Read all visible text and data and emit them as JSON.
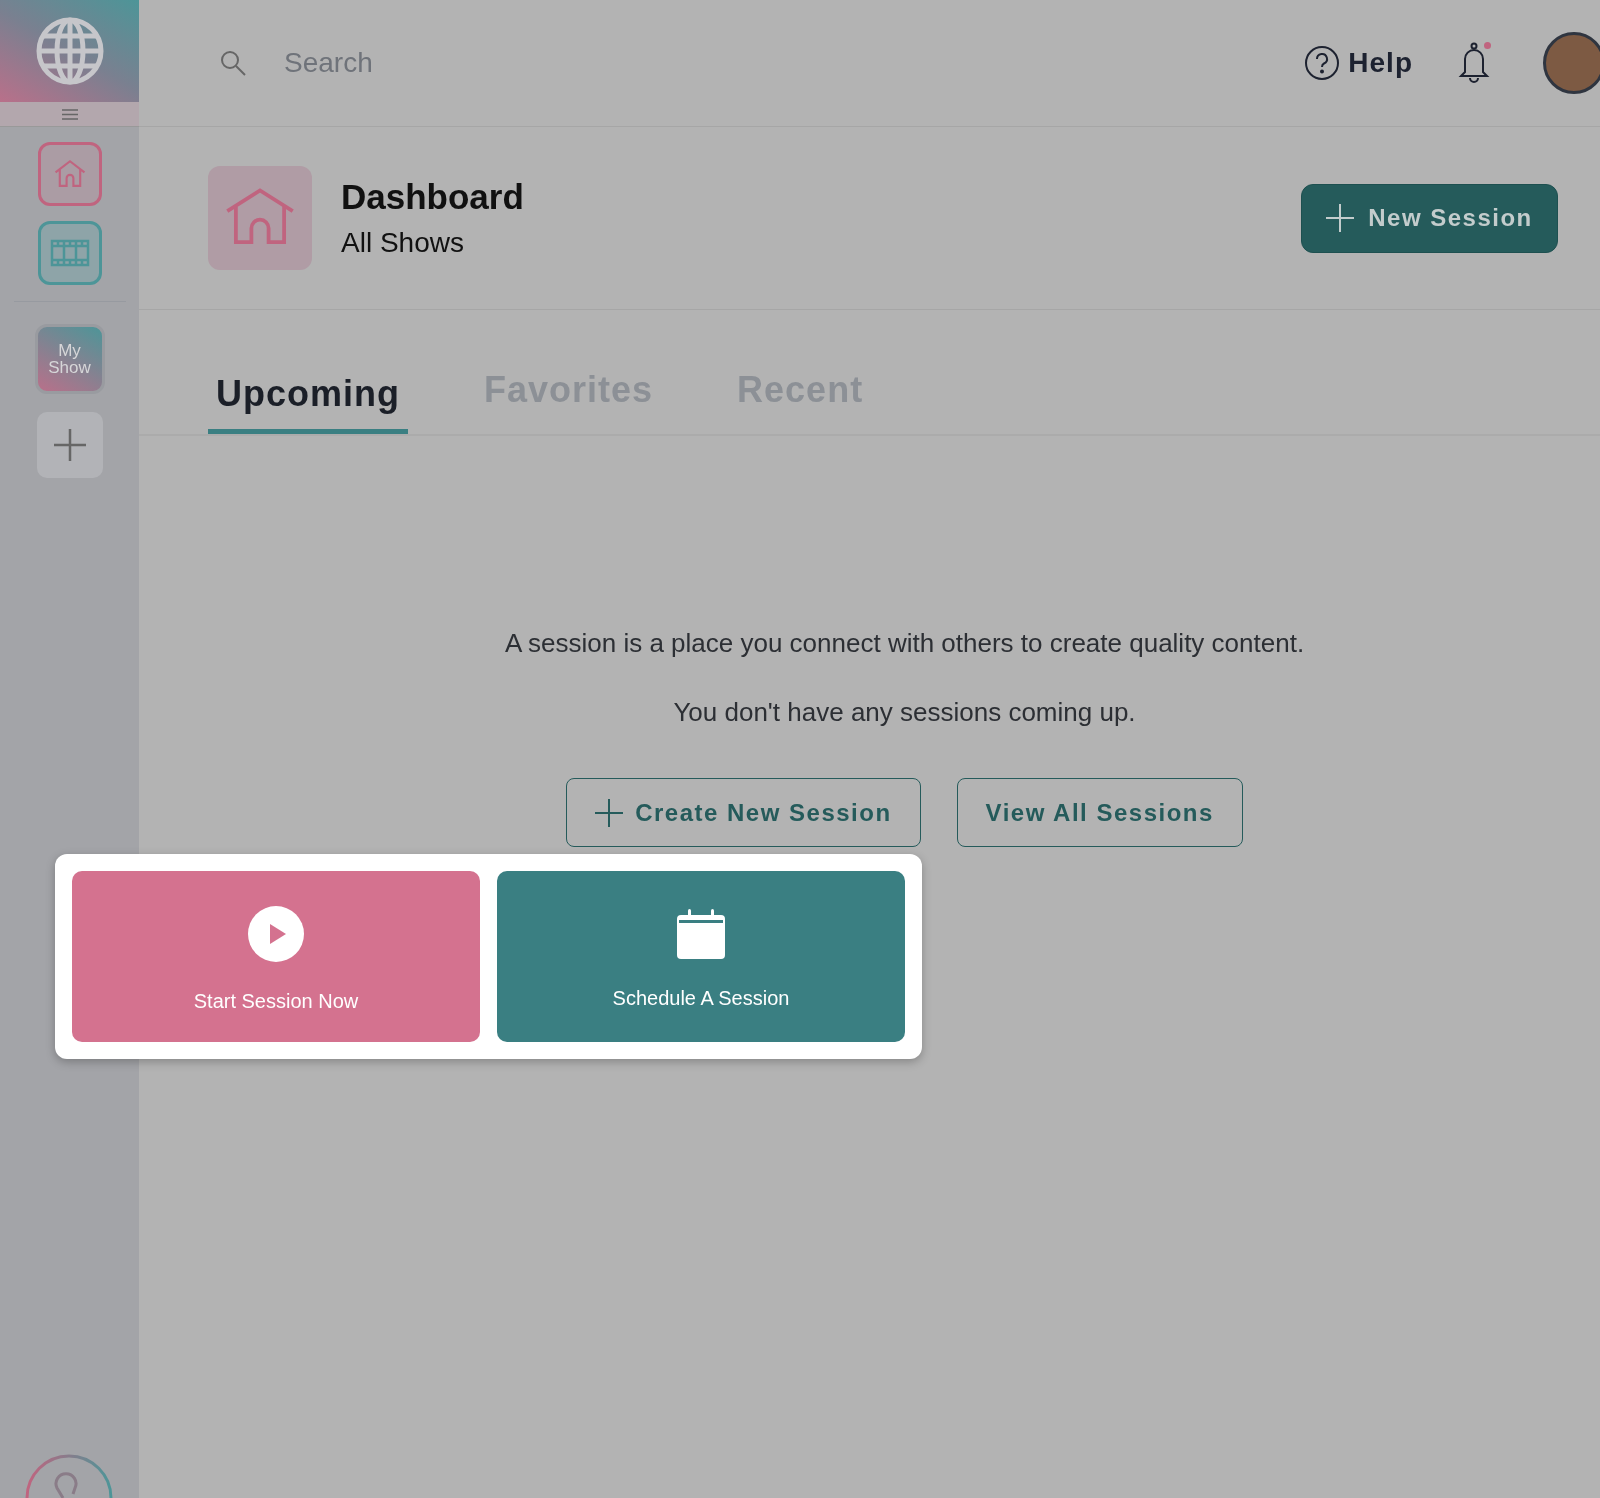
{
  "sidebar": {
    "items": [
      {
        "kind": "home"
      },
      {
        "kind": "film"
      }
    ],
    "shows": [
      {
        "label": "My Show"
      }
    ]
  },
  "header": {
    "search": {
      "placeholder": "Search"
    },
    "help": "Help",
    "notifications": {
      "unread": true
    }
  },
  "page": {
    "title": "Dashboard",
    "subtitle": "All Shows",
    "new_session_button": "New Session"
  },
  "tabs": [
    {
      "label": "Upcoming",
      "selected": true
    },
    {
      "label": "Favorites",
      "selected": false
    },
    {
      "label": "Recent",
      "selected": false
    }
  ],
  "empty_state": {
    "lines": [
      "A session is a place you connect with others to create quality content.",
      "You don't have any sessions coming up."
    ],
    "buttons": [
      {
        "label": "Create New Session",
        "kind": "create"
      },
      {
        "label": "View All Sessions",
        "kind": "view"
      }
    ]
  },
  "popup": {
    "options": [
      {
        "label": "Start Session Now",
        "kind": "start"
      },
      {
        "label": "Schedule A Session",
        "kind": "schedule"
      }
    ]
  }
}
